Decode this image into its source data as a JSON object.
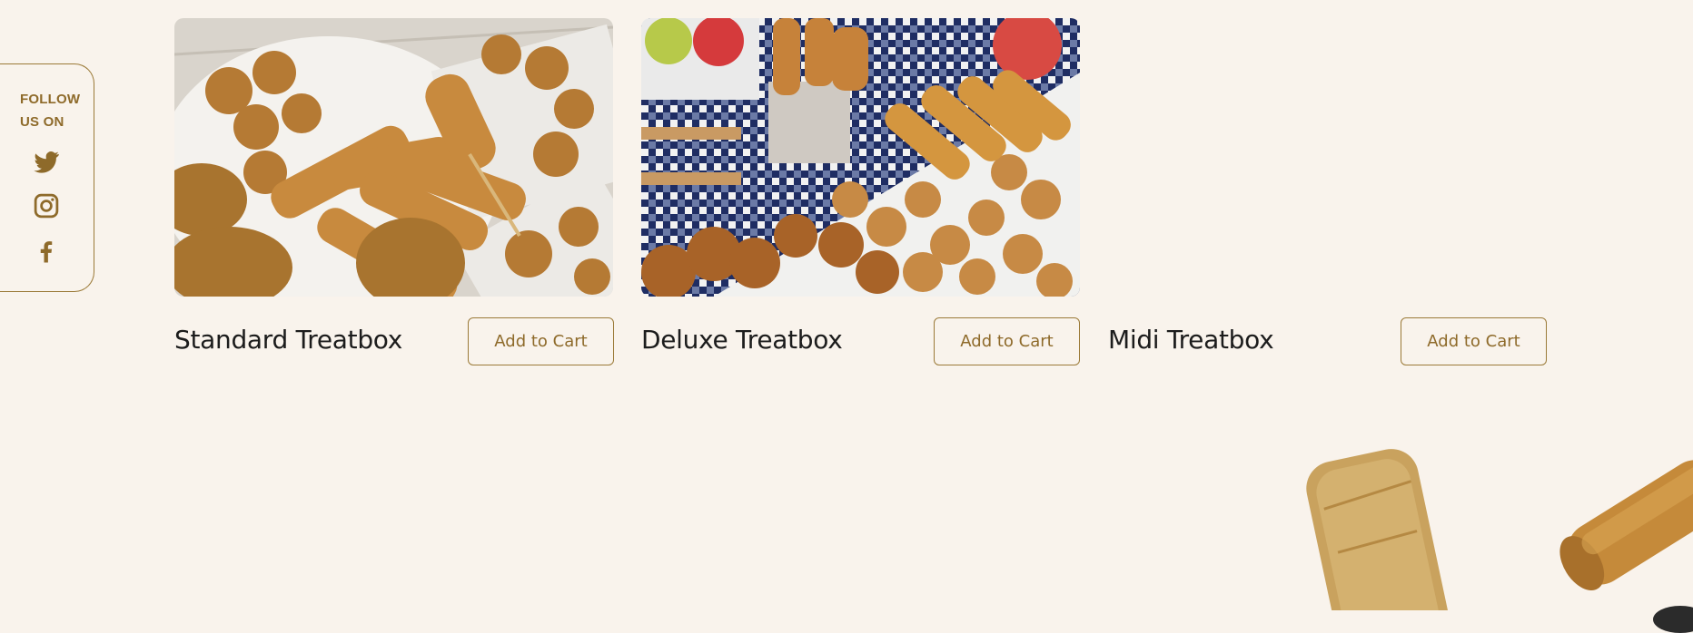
{
  "social": {
    "follow_line1": "FOLLOW",
    "follow_line2": "US ON",
    "icons": [
      "twitter-icon",
      "instagram-icon",
      "facebook-icon"
    ],
    "color": "#8e6a2a"
  },
  "products": [
    {
      "title": "Standard Treatbox",
      "button": "Add to Cart"
    },
    {
      "title": "Deluxe Treatbox",
      "button": "Add to Cart"
    },
    {
      "title": "Midi Treatbox",
      "button": "Add to Cart"
    }
  ],
  "colors": {
    "background": "#f9f3ec",
    "accent": "#9b7a38",
    "text": "#1c1c1c"
  }
}
